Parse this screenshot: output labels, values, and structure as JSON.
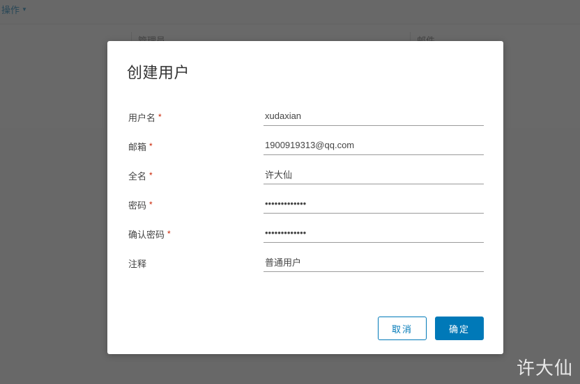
{
  "background": {
    "topLink": "操作",
    "headerCol1": "管理员",
    "headerCol2": "邮件"
  },
  "dialog": {
    "title": "创建用户",
    "fields": {
      "username": {
        "label": "用户名",
        "required": true,
        "value": "xudaxian"
      },
      "email": {
        "label": "邮箱",
        "required": true,
        "value": "1900919313@qq.com"
      },
      "fullname": {
        "label": "全名",
        "required": true,
        "value": "许大仙"
      },
      "password": {
        "label": "密码",
        "required": true,
        "value": "•••••••••••••"
      },
      "confirm": {
        "label": "确认密码",
        "required": true,
        "value": "•••••••••••••"
      },
      "comment": {
        "label": "注释",
        "required": false,
        "value": "普通用户"
      }
    },
    "buttons": {
      "cancel": "取消",
      "ok": "确定"
    }
  },
  "watermark": "许大仙"
}
